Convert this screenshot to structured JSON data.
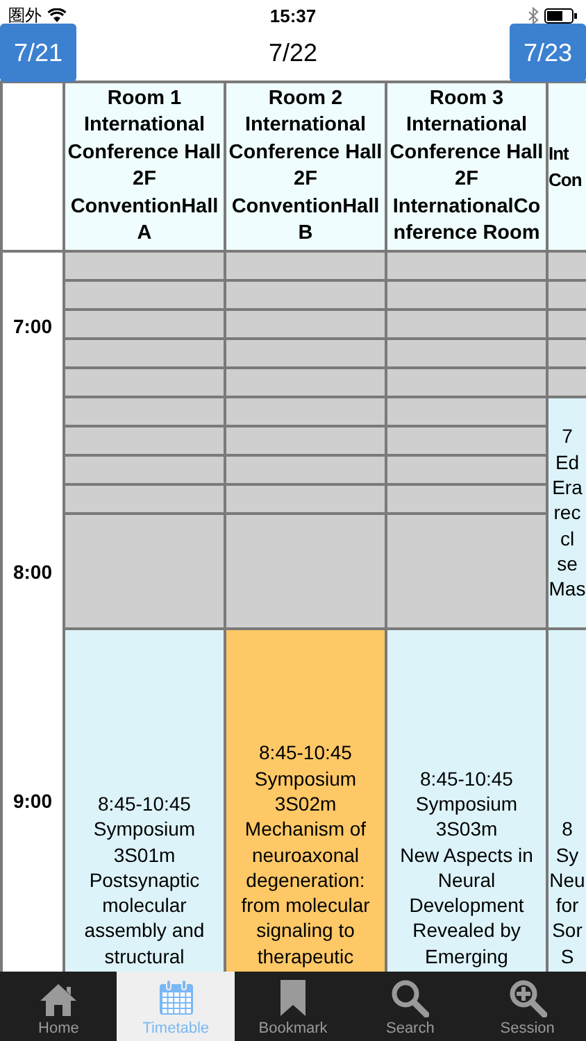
{
  "status_bar": {
    "carrier": "圏外",
    "time": "15:37"
  },
  "nav": {
    "prev": "7/21",
    "title": "7/22",
    "next": "7/23"
  },
  "time_column": [
    {
      "kind": "empty"
    },
    {
      "kind": "empty"
    },
    {
      "kind": "label",
      "label": "7:00"
    },
    {
      "kind": "empty"
    },
    {
      "kind": "empty"
    },
    {
      "kind": "empty"
    },
    {
      "kind": "empty"
    },
    {
      "kind": "empty"
    },
    {
      "kind": "empty"
    },
    {
      "kind": "label",
      "label": "8:00"
    },
    {
      "kind": "label",
      "label": "9:00"
    }
  ],
  "rooms": [
    {
      "header": [
        "Room 1",
        "International",
        "Conference Hall",
        "2F",
        "ConventionHall",
        "A"
      ],
      "cells": [
        {
          "kind": "closed"
        },
        {
          "kind": "closed"
        },
        {
          "kind": "closed"
        },
        {
          "kind": "closed"
        },
        {
          "kind": "closed"
        },
        {
          "kind": "closed"
        },
        {
          "kind": "closed"
        },
        {
          "kind": "closed"
        },
        {
          "kind": "closed"
        },
        {
          "kind": "closed"
        },
        {
          "kind": "session",
          "highlighted": false,
          "lines": [
            "8:45-10:45",
            "Symposium",
            "3S01m",
            "Postsynaptic",
            "molecular",
            "assembly and",
            "structural"
          ]
        }
      ]
    },
    {
      "header": [
        "Room 2",
        "International",
        "Conference Hall",
        "2F",
        "ConventionHall",
        "B"
      ],
      "cells": [
        {
          "kind": "closed"
        },
        {
          "kind": "closed"
        },
        {
          "kind": "closed"
        },
        {
          "kind": "closed"
        },
        {
          "kind": "closed"
        },
        {
          "kind": "closed"
        },
        {
          "kind": "closed"
        },
        {
          "kind": "closed"
        },
        {
          "kind": "closed"
        },
        {
          "kind": "closed"
        },
        {
          "kind": "session",
          "highlighted": true,
          "lines": [
            "8:45-10:45",
            "Symposium",
            "3S02m",
            "Mechanism of",
            "neuroaxonal",
            "degeneration:",
            "from molecular",
            "signaling to",
            "therapeutic"
          ]
        }
      ]
    },
    {
      "header": [
        "Room 3",
        "International",
        "Conference Hall",
        "2F",
        "InternationalCo",
        "nference Room"
      ],
      "cells": [
        {
          "kind": "closed"
        },
        {
          "kind": "closed"
        },
        {
          "kind": "closed"
        },
        {
          "kind": "closed"
        },
        {
          "kind": "closed"
        },
        {
          "kind": "closed"
        },
        {
          "kind": "closed"
        },
        {
          "kind": "closed"
        },
        {
          "kind": "closed"
        },
        {
          "kind": "closed"
        },
        {
          "kind": "session",
          "highlighted": false,
          "lines": [
            "8:45-10:45",
            "Symposium",
            "3S03m",
            "New Aspects in",
            "Neural",
            "Development",
            "Revealed by",
            "Emerging"
          ]
        }
      ]
    },
    {
      "header": [
        "Int",
        "Con"
      ],
      "cells": [
        {
          "kind": "closed"
        },
        {
          "kind": "closed"
        },
        {
          "kind": "closed"
        },
        {
          "kind": "closed"
        },
        {
          "kind": "closed"
        },
        {
          "kind": "session",
          "highlighted": false,
          "lines": [
            "7",
            "Ed",
            "Era",
            "rec",
            "cl",
            "se",
            "Mas"
          ]
        },
        {
          "kind": "session",
          "highlighted": false,
          "lines": [
            "8",
            "Sy",
            "Neu",
            "for",
            "Sor",
            "S"
          ]
        }
      ]
    }
  ],
  "tab_bar": [
    {
      "label": "Home",
      "selected": false
    },
    {
      "label": "Timetable",
      "selected": true
    },
    {
      "label": "Bookmark",
      "selected": false
    },
    {
      "label": "Search",
      "selected": false
    },
    {
      "label": "Session",
      "selected": false
    }
  ]
}
